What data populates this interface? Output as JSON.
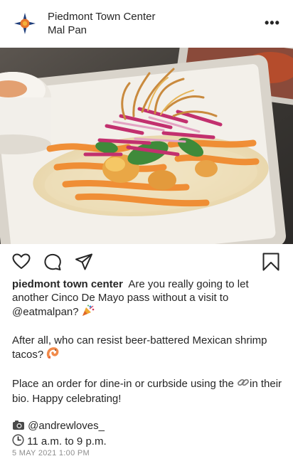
{
  "header": {
    "account_name": "Piedmont Town Center",
    "location": "Mal Pan",
    "more_label": "•••"
  },
  "photo": {
    "icon": "taco-photo"
  },
  "actions": {
    "like_icon": "heart-icon",
    "comment_icon": "comment-icon",
    "share_icon": "paper-plane-icon",
    "save_icon": "bookmark-icon"
  },
  "caption": {
    "username": "piedmont town center",
    "p1_text": "Are you really going to let another Cinco De Mayo pass without a visit to @eatmalpan?",
    "p1_emoji": "party-popper-icon",
    "p2_text": "After all, who can resist beer-battered Mexican shrimp tacos?",
    "p2_emoji": "shrimp-icon",
    "p3_before": "Place an order for dine-in or curbside using the",
    "p3_emoji": "link-icon",
    "p3_after": "in their bio. Happy celebrating!",
    "credit_emoji": "camera-icon",
    "credit": "@andrewloves_",
    "hours_emoji": "clock-icon",
    "hours": "11 a.m. to 9 p.m."
  },
  "date": "5 MAY 2021 1:00 PM",
  "colors": {
    "text": "#262626",
    "muted": "#8e8e8e",
    "sauce": "#f08a2e",
    "cabbage": "#c2306e",
    "tray": "#f3f0ea"
  }
}
